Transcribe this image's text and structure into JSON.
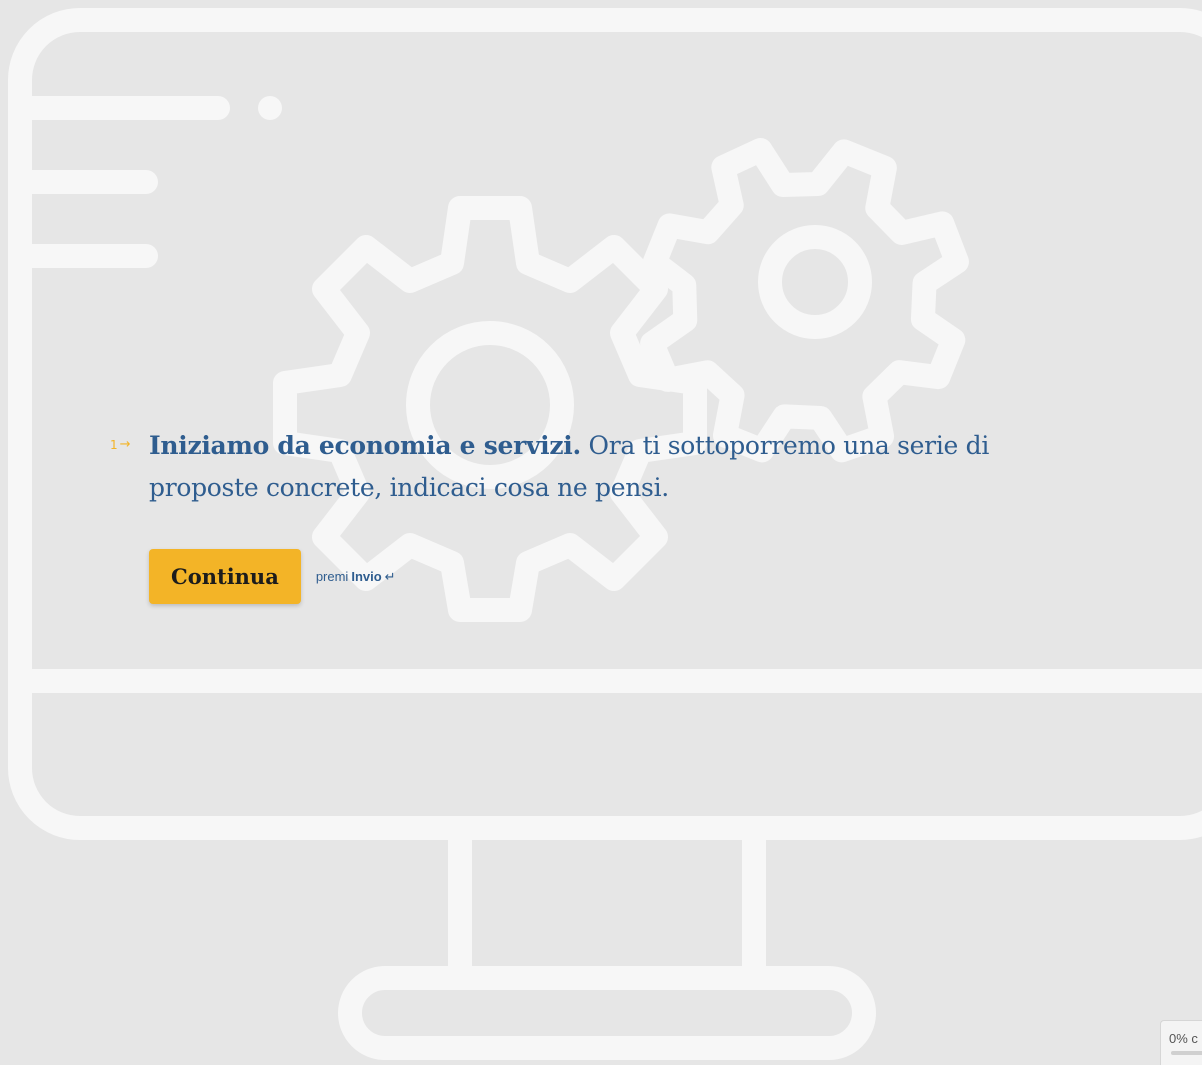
{
  "question": {
    "number": "1",
    "arrow_icon": "arrow-right-icon",
    "heading": "Iniziamo da economia e servizi.",
    "body": " Ora ti sottoporremo una serie di proposte concrete, indicaci cosa ne pensi."
  },
  "actions": {
    "continue_label": "Continua",
    "hint_prefix": "premi",
    "hint_key": "Invio",
    "enter_icon": "enter-key-icon"
  },
  "progress": {
    "label": "0% c",
    "fraction": 0
  },
  "colors": {
    "background": "#e6e6e6",
    "illustration": "#f7f7f7",
    "accent": "#f3b427",
    "text": "#2f5d8f"
  },
  "illustration": {
    "icons": [
      "monitor-icon",
      "large-gear-icon",
      "small-gear-icon"
    ]
  }
}
